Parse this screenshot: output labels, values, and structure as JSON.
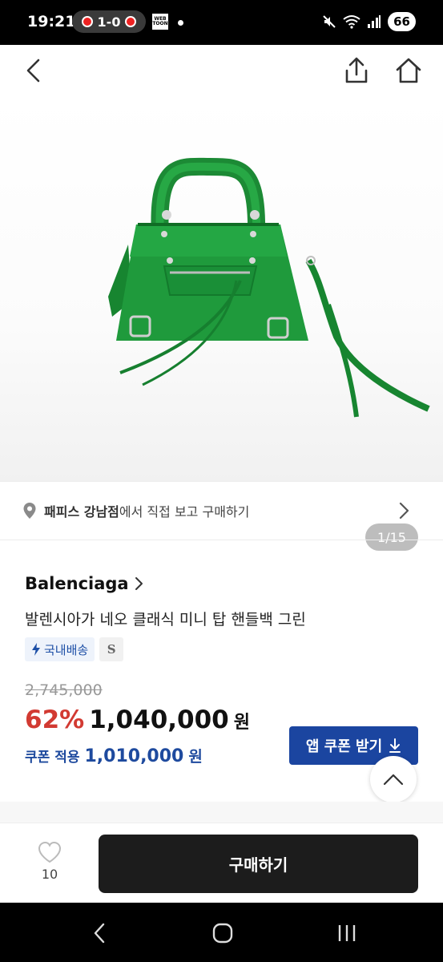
{
  "status_bar": {
    "time": "19:21",
    "score": "1-0",
    "webtoon_label": "WEB TOON",
    "battery": "66"
  },
  "header": {
    "back_icon": "chevron-left-icon",
    "share_icon": "share-icon",
    "home_icon": "home-icon"
  },
  "gallery": {
    "counter": "1/15",
    "bag_color": "#1f9a3c"
  },
  "store_banner": {
    "store_name": "패피스 강남점",
    "suffix": "에서 직접 보고 구매하기"
  },
  "product": {
    "brand": "Balenciaga",
    "title": "발렌시아가 네오 클래식 미니 탑 핸들백 그린",
    "shipping_tag": "국내배송",
    "grade_tag": "S",
    "original_price": "2,745,000",
    "discount": "62%",
    "price": "1,040,000",
    "currency": "원",
    "coupon_label": "쿠폰 적용",
    "coupon_price": "1,010,000",
    "coupon_button": "앱 쿠폰 받기"
  },
  "bottom_bar": {
    "like_count": "10",
    "buy_label": "구매하기"
  },
  "colors": {
    "discount_red": "#d23a32",
    "coupon_blue": "#1b45a0",
    "buy_button": "#1c1c1c"
  }
}
